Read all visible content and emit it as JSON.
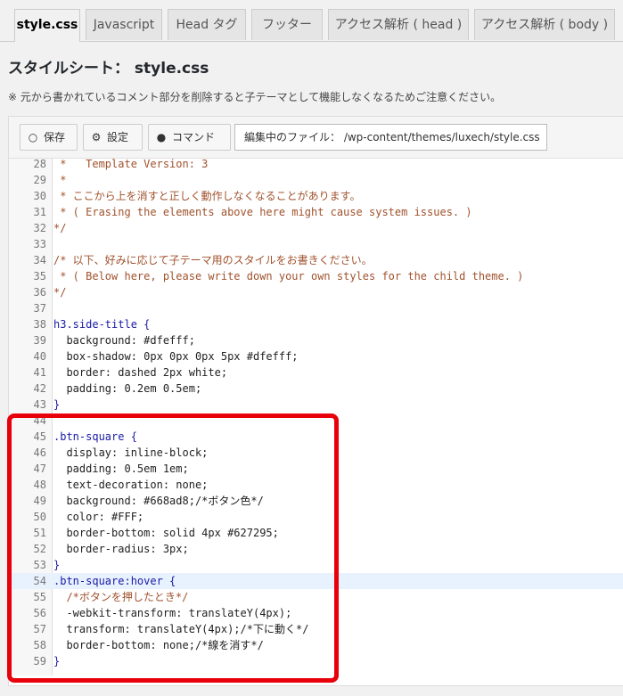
{
  "tabs": [
    {
      "label": "style.css",
      "active": true
    },
    {
      "label": "Javascript",
      "active": false
    },
    {
      "label": "Head タグ",
      "active": false
    },
    {
      "label": "フッター",
      "active": false
    },
    {
      "label": "アクセス解析 ( head )",
      "active": false
    },
    {
      "label": "アクセス解析 ( body )",
      "active": false
    }
  ],
  "page": {
    "title": "スタイルシート： style.css",
    "note": "※ 元から書かれているコメント部分を削除すると子テーマとして機能しなくなるためご注意ください。"
  },
  "toolbar": {
    "save_label": "保存",
    "settings_label": "設定",
    "command_label": "コマンド",
    "file_label": "編集中のファイル： /wp-content/themes/luxech/style.css"
  },
  "code_lines": [
    {
      "n": "28",
      "t": " *   Template Version: 3"
    },
    {
      "n": "29",
      "t": " *"
    },
    {
      "n": "30",
      "t": " * ここから上を消すと正しく動作しなくなることがあります。"
    },
    {
      "n": "31",
      "t": " * ( Erasing the elements above here might cause system issues. )"
    },
    {
      "n": "32",
      "t": "*/"
    },
    {
      "n": "33",
      "t": ""
    },
    {
      "n": "34",
      "t": "/* 以下、好みに応じて子テーマ用のスタイルをお書きください。"
    },
    {
      "n": "35",
      "t": " * ( Below here, please write down your own styles for the child theme. )"
    },
    {
      "n": "36",
      "t": "*/"
    },
    {
      "n": "37",
      "t": ""
    },
    {
      "n": "38",
      "t": "h3.side-title {"
    },
    {
      "n": "39",
      "t": "  background: #dfefff;"
    },
    {
      "n": "40",
      "t": "  box-shadow: 0px 0px 0px 5px #dfefff;"
    },
    {
      "n": "41",
      "t": "  border: dashed 2px white;"
    },
    {
      "n": "42",
      "t": "  padding: 0.2em 0.5em;"
    },
    {
      "n": "43",
      "t": "}"
    },
    {
      "n": "44",
      "t": ""
    },
    {
      "n": "45",
      "t": ".btn-square {"
    },
    {
      "n": "46",
      "t": "  display: inline-block;"
    },
    {
      "n": "47",
      "t": "  padding: 0.5em 1em;"
    },
    {
      "n": "48",
      "t": "  text-decoration: none;"
    },
    {
      "n": "49",
      "t": "  background: #668ad8;/*ボタン色*/"
    },
    {
      "n": "50",
      "t": "  color: #FFF;"
    },
    {
      "n": "51",
      "t": "  border-bottom: solid 4px #627295;"
    },
    {
      "n": "52",
      "t": "  border-radius: 3px;"
    },
    {
      "n": "53",
      "t": "}"
    },
    {
      "n": "54",
      "t": ".btn-square:hover {",
      "highlight": true
    },
    {
      "n": "55",
      "t": "  /*ボタンを押したとき*/"
    },
    {
      "n": "56",
      "t": "  -webkit-transform: translateY(4px);"
    },
    {
      "n": "57",
      "t": "  transform: translateY(4px);/*下に動く*/"
    },
    {
      "n": "58",
      "t": "  border-bottom: none;/*線を消す*/"
    },
    {
      "n": "59",
      "t": "}"
    }
  ],
  "annotation": {
    "color": "#e8000b"
  }
}
